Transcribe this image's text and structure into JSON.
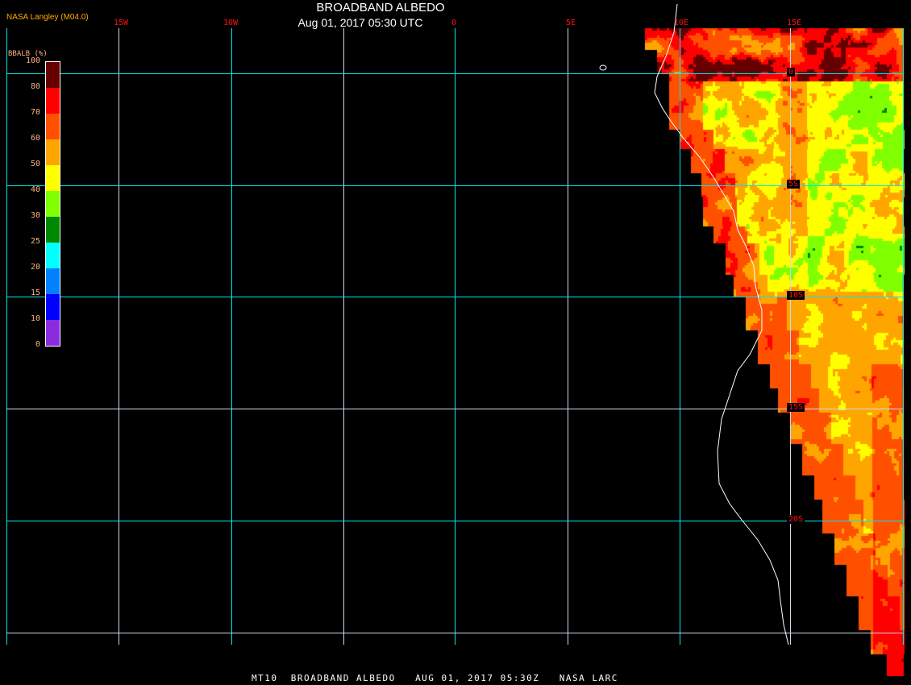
{
  "header": {
    "title": "BROADBAND ALBEDO",
    "subtitle": "Aug 01, 2017 05:30 UTC",
    "credit": "NASA Langley (M04.0)"
  },
  "longitude_labels": [
    "15W",
    "10W",
    "0",
    "5E",
    "10E",
    "15E"
  ],
  "latitude_labels": [
    "0",
    "5S",
    "10S",
    "15S",
    "20S"
  ],
  "colorbar": {
    "title": "BBALB (%)",
    "labels": [
      "100",
      "80",
      "70",
      "60",
      "50",
      "40",
      "30",
      "25",
      "20",
      "15",
      "10",
      "0"
    ],
    "colors": [
      "#660000",
      "#ff0000",
      "#ff5000",
      "#ffa500",
      "#ffff00",
      "#80ff00",
      "#008800",
      "#00ffff",
      "#0080ff",
      "#0000ff",
      "#8a2be2"
    ]
  },
  "footer": "MT10  BROADBAND ALBEDO   AUG 01, 2017 05:30Z   NASA LARC",
  "colors": {
    "grid_primary": "#00e8f0",
    "grid_secondary": "#c8dce8",
    "coastline": "#ffffff"
  }
}
